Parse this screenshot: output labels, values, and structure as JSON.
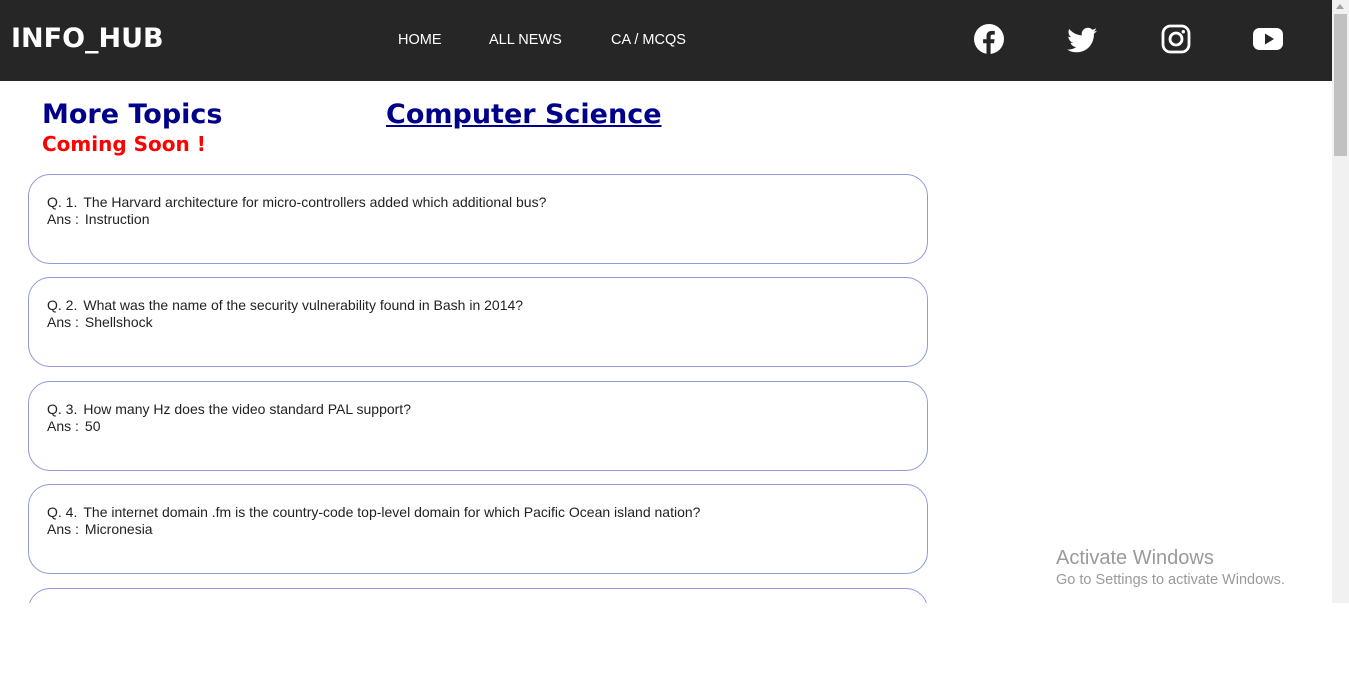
{
  "header": {
    "brand": "INFO_HUB",
    "nav": [
      {
        "label": "HOME"
      },
      {
        "label": "ALL NEWS"
      },
      {
        "label": "CA / MCQS"
      }
    ],
    "social_icons": [
      "facebook-icon",
      "twitter-icon",
      "instagram-icon",
      "youtube-icon"
    ]
  },
  "sidebar": {
    "more_topics": "More Topics",
    "coming_soon": "Coming Soon !"
  },
  "main": {
    "title": "Computer Science",
    "questions": [
      {
        "num": "Q. 1.",
        "question": "The Harvard architecture for micro-controllers added which additional bus?",
        "ans_label": "Ans :",
        "answer": "Instruction"
      },
      {
        "num": "Q. 2.",
        "question": "What was the name of the security vulnerability found in Bash in 2014?",
        "ans_label": "Ans :",
        "answer": "Shellshock"
      },
      {
        "num": "Q. 3.",
        "question": "How many Hz does the video standard PAL support?",
        "ans_label": "Ans :",
        "answer": "50"
      },
      {
        "num": "Q. 4.",
        "question": "The internet domain .fm is the country-code top-level domain for which Pacific Ocean island nation?",
        "ans_label": "Ans :",
        "answer": "Micronesia"
      }
    ]
  },
  "watermark": {
    "title": "Activate Windows",
    "subtitle": "Go to Settings to activate Windows."
  },
  "colors": {
    "navbar_bg": "#262626",
    "heading": "#00008b",
    "coming_soon": "#ff0000",
    "card_border": "#8e9bd6"
  }
}
